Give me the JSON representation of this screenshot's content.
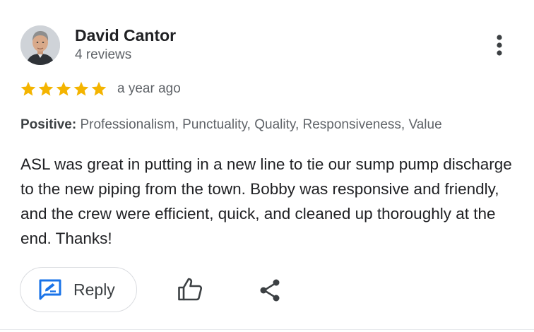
{
  "review": {
    "reviewer": {
      "name": "David Cantor",
      "review_count": "4 reviews",
      "avatar_icon": "reviewer-photo"
    },
    "rating": {
      "stars": 5,
      "max_stars": 5,
      "time": "a year ago",
      "star_color": "#f4b400"
    },
    "highlights": {
      "label": "Positive:",
      "values": " Professionalism, Punctuality, Quality, Responsiveness, Value"
    },
    "text": "ASL was great in putting in a new line to tie our sump pump discharge to the new piping from the town. Bobby was responsive and friendly, and the crew were efficient, quick, and cleaned up thoroughly at the end. Thanks!",
    "actions": {
      "reply_label": "Reply",
      "reply_icon": "edit-reply-icon",
      "like_icon": "thumbs-up-icon",
      "share_icon": "share-icon",
      "more_icon": "more-vertical-icon"
    }
  },
  "colors": {
    "accent": "#1a73e8",
    "text_primary": "#202124",
    "text_secondary": "#5f6368",
    "outline": "#dadce0"
  }
}
